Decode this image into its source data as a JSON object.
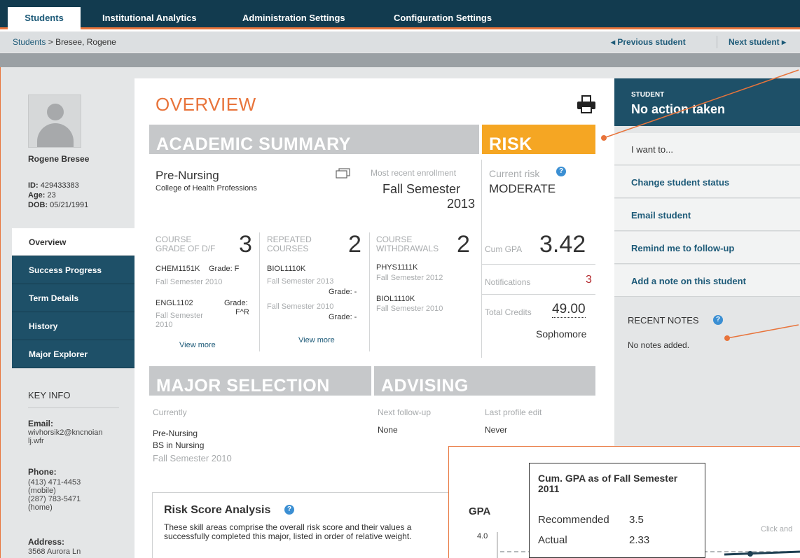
{
  "nav": {
    "tabs": [
      {
        "label": "Students"
      },
      {
        "label": "Institutional Analytics"
      },
      {
        "label": "Administration Settings"
      },
      {
        "label": "Configuration Settings"
      }
    ]
  },
  "breadcrumb": {
    "root": "Students",
    "separator": " > ",
    "current": "Bresee, Rogene",
    "previous": "◂ Previous student",
    "next": "Next student ▸"
  },
  "student": {
    "name": "Rogene Bresee",
    "id_label": "ID:",
    "id": "429433383",
    "age_label": "Age:",
    "age": "23",
    "dob_label": "DOB:",
    "dob": "05/21/1991"
  },
  "sidenav": {
    "items": [
      {
        "label": "Overview"
      },
      {
        "label": "Success Progress"
      },
      {
        "label": "Term Details"
      },
      {
        "label": "History"
      },
      {
        "label": "Major Explorer"
      }
    ]
  },
  "keyinfo": {
    "title": "KEY INFO",
    "email_label": "Email:",
    "email_1": "wivhorsik2@kncnoian",
    "email_2": "lj.wfr",
    "phone_label": "Phone:",
    "phone_1": "(413) 471-4453",
    "phone_1_type": "(mobile)",
    "phone_2": "(287) 783-5471",
    "phone_2_type": "(home)",
    "address_label": "Address:",
    "address_1": "3568 Aurora Ln"
  },
  "overview": {
    "title": "OVERVIEW",
    "academic_summary": "ACADEMIC SUMMARY",
    "risk": "RISK",
    "program": "Pre-Nursing",
    "college": "College of Health Professions",
    "recent_enrollment_label": "Most recent enrollment",
    "recent_enrollment_1": "Fall Semester",
    "recent_enrollment_2": "2013",
    "current_risk_label": "Current risk",
    "current_risk": "MODERATE",
    "course_grade_label_1": "COURSE",
    "course_grade_label_2": "GRADE OF D/F",
    "course_grade_count": "3",
    "repeated_label_1": "REPEATED",
    "repeated_label_2": "COURSES",
    "repeated_count": "2",
    "withdrawals_label_1": "COURSE",
    "withdrawals_label_2": "WITHDRAWALS",
    "withdrawals_count": "2",
    "grade_df": [
      {
        "course": "CHEM1151K",
        "grade": "Grade: F",
        "term": "Fall Semester 2010"
      },
      {
        "course": "ENGL1102",
        "grade": "Grade:",
        "grade_2": "F^R",
        "term_1": "Fall Semester",
        "term_2": "2010"
      }
    ],
    "repeated": [
      {
        "course": "BIOL1110K",
        "term_1": "Fall Semester 2013",
        "grade_1": "Grade: -",
        "term_2": "Fall Semester 2010",
        "grade_2": "Grade: -"
      }
    ],
    "withdrawals": [
      {
        "course": "PHYS1111K",
        "term": "Fall Semester 2012"
      },
      {
        "course": "BIOL1110K",
        "term": "Fall Semester 2010"
      }
    ],
    "view_more": "View more",
    "cum_gpa_label": "Cum GPA",
    "cum_gpa": "3.42",
    "notifications_label": "Notifications",
    "notifications": "3",
    "total_credits_label": "Total Credits",
    "total_credits": "49.00",
    "class_level": "Sophomore",
    "major_selection": "MAJOR SELECTION",
    "advising": "ADVISING",
    "currently_label": "Currently",
    "major_1": "Pre-Nursing",
    "major_2": "BS in Nursing",
    "major_3": "Fall Semester 2010",
    "next_followup_label": "Next follow-up",
    "next_followup": "None",
    "last_edit_label": "Last profile edit",
    "last_edit": "Never"
  },
  "risk_analysis": {
    "title": "Risk Score Analysis",
    "desc_1": "These skill areas comprise the overall risk score and their values a",
    "desc_2": "successfully completed this major, listed in order of relative weight."
  },
  "right_panel": {
    "student_label": "STUDENT",
    "status": "No action taken",
    "i_want_to": "I want to...",
    "actions": [
      {
        "label": "Change student status"
      },
      {
        "label": "Email student"
      },
      {
        "label": "Remind me to follow-up"
      },
      {
        "label": "Add a note on this student"
      }
    ],
    "recent_notes": "RECENT NOTES",
    "no_notes": "No notes added."
  },
  "chart": {
    "gpa_label": "GPA",
    "y_tick": "4.0",
    "hint": "Click and",
    "tooltip_title_1": "Cum. GPA as of Fall Semester",
    "tooltip_title_2": "2011",
    "recommended_label": "Recommended",
    "recommended": "3.5",
    "actual_label": "Actual",
    "actual": "2.33"
  },
  "colors": {
    "accent": "#e8743b",
    "nav": "#123b4f",
    "link": "#1d5a78",
    "risk_bar": "#f5a623"
  }
}
